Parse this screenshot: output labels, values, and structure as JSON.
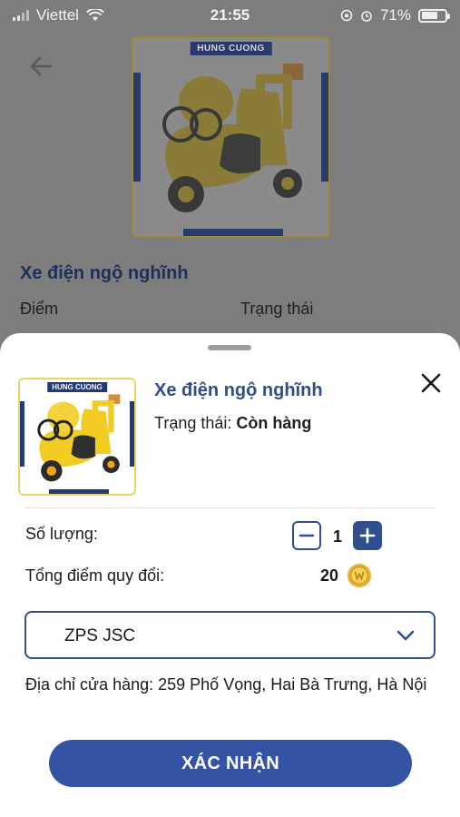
{
  "status_bar": {
    "carrier": "Viettel",
    "time": "21:55",
    "battery": "71%"
  },
  "background": {
    "brand": "HUNG CUONG",
    "title": "Xe điện ngộ nghĩnh",
    "col_points_label": "Điểm",
    "col_status_label": "Trạng thái"
  },
  "sheet": {
    "brand": "HUNG CUONG",
    "product_name": "Xe điện ngộ nghĩnh",
    "status_label": "Trạng thái:",
    "status_value": "Còn hàng",
    "quantity_label": "Số lượng:",
    "quantity_value": "1",
    "total_label": "Tổng điểm quy đổi:",
    "total_value": "20",
    "store_selected": "ZPS JSC",
    "address": "Địa chỉ cửa hàng: 259 Phố Vọng, Hai Bà Trưng, Hà Nội",
    "confirm_label": "XÁC NHẬN"
  },
  "colors": {
    "accent": "#3453a4",
    "title": "#2e4e8c",
    "toy_yellow": "#f2cc22",
    "overlay": "#7d7d7d"
  },
  "icons": [
    "back-arrow-icon",
    "wifi-icon",
    "close-icon",
    "minus-icon",
    "plus-icon",
    "coin-icon",
    "chevron-down-icon",
    "alarm-icon",
    "lock-rotation-icon"
  ]
}
